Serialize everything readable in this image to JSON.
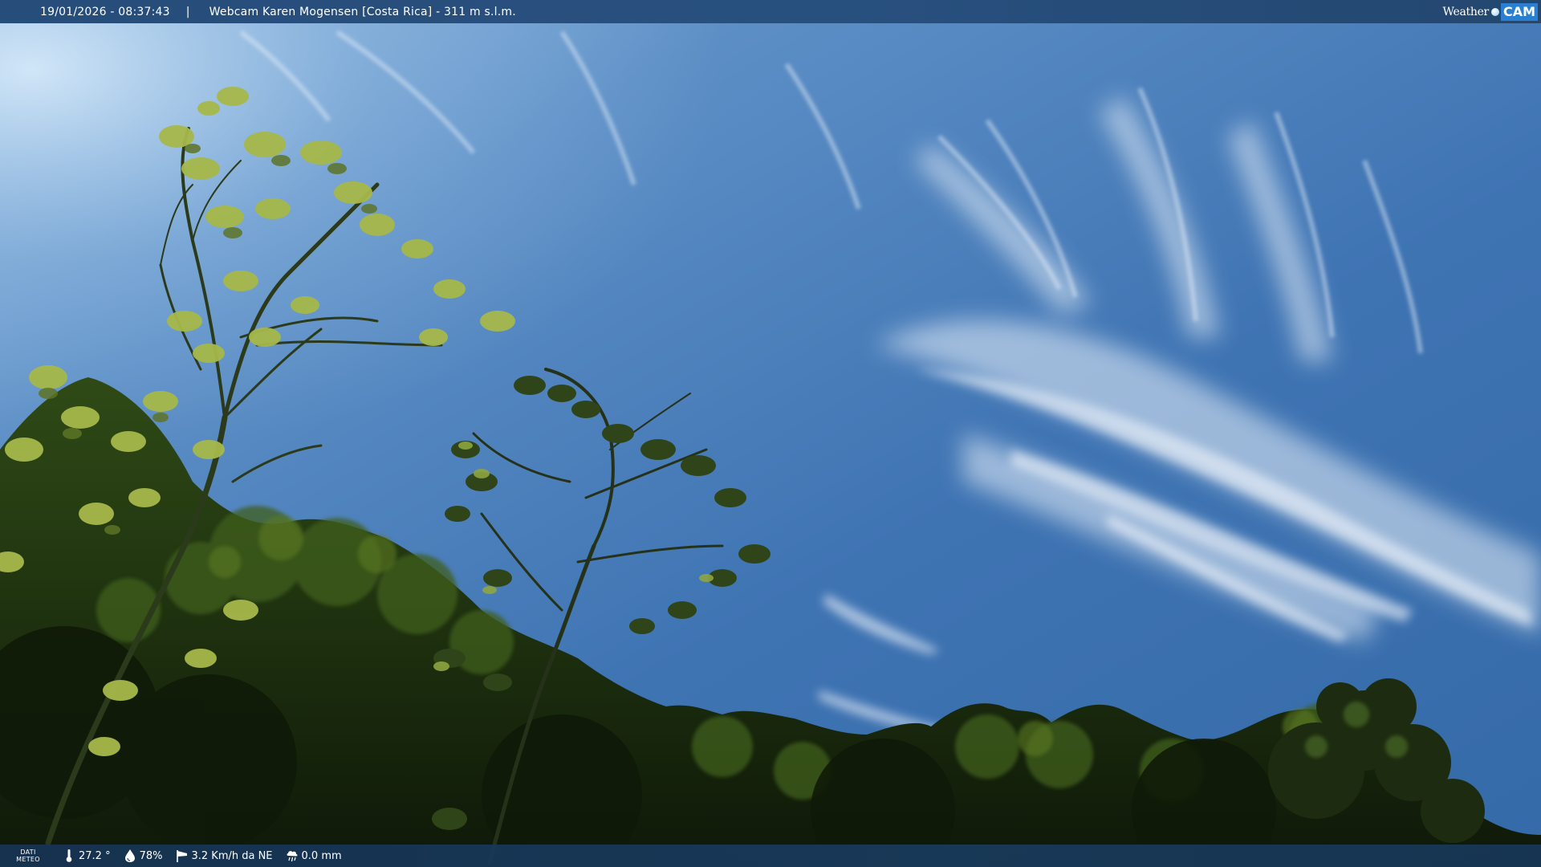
{
  "header": {
    "timestamp": "19/01/2026 - 08:37:43",
    "separator": "|",
    "caption": "Webcam Karen Mogensen [Costa Rica] - 311 m s.l.m."
  },
  "logo": {
    "word_weather": "Weather",
    "word_cam": "CAM"
  },
  "footer": {
    "label_line1": "DATI",
    "label_line2": "METEO",
    "temperature": "27.2 °",
    "humidity": "78%",
    "wind": "3.2 Km/h da NE",
    "rain": "0.0 mm"
  },
  "icons": {
    "temperature": "thermometer-icon",
    "humidity": "water-drop-icon",
    "wind": "windsock-icon",
    "rain": "rain-cloud-icon"
  },
  "colors": {
    "sky_top": "#2b5c97",
    "sky_bright": "#6f9fd0",
    "foliage_dark": "#14220c",
    "foliage_light": "#8fa638",
    "bar": "#274d7a",
    "logo_accent": "#2a7fd0"
  }
}
